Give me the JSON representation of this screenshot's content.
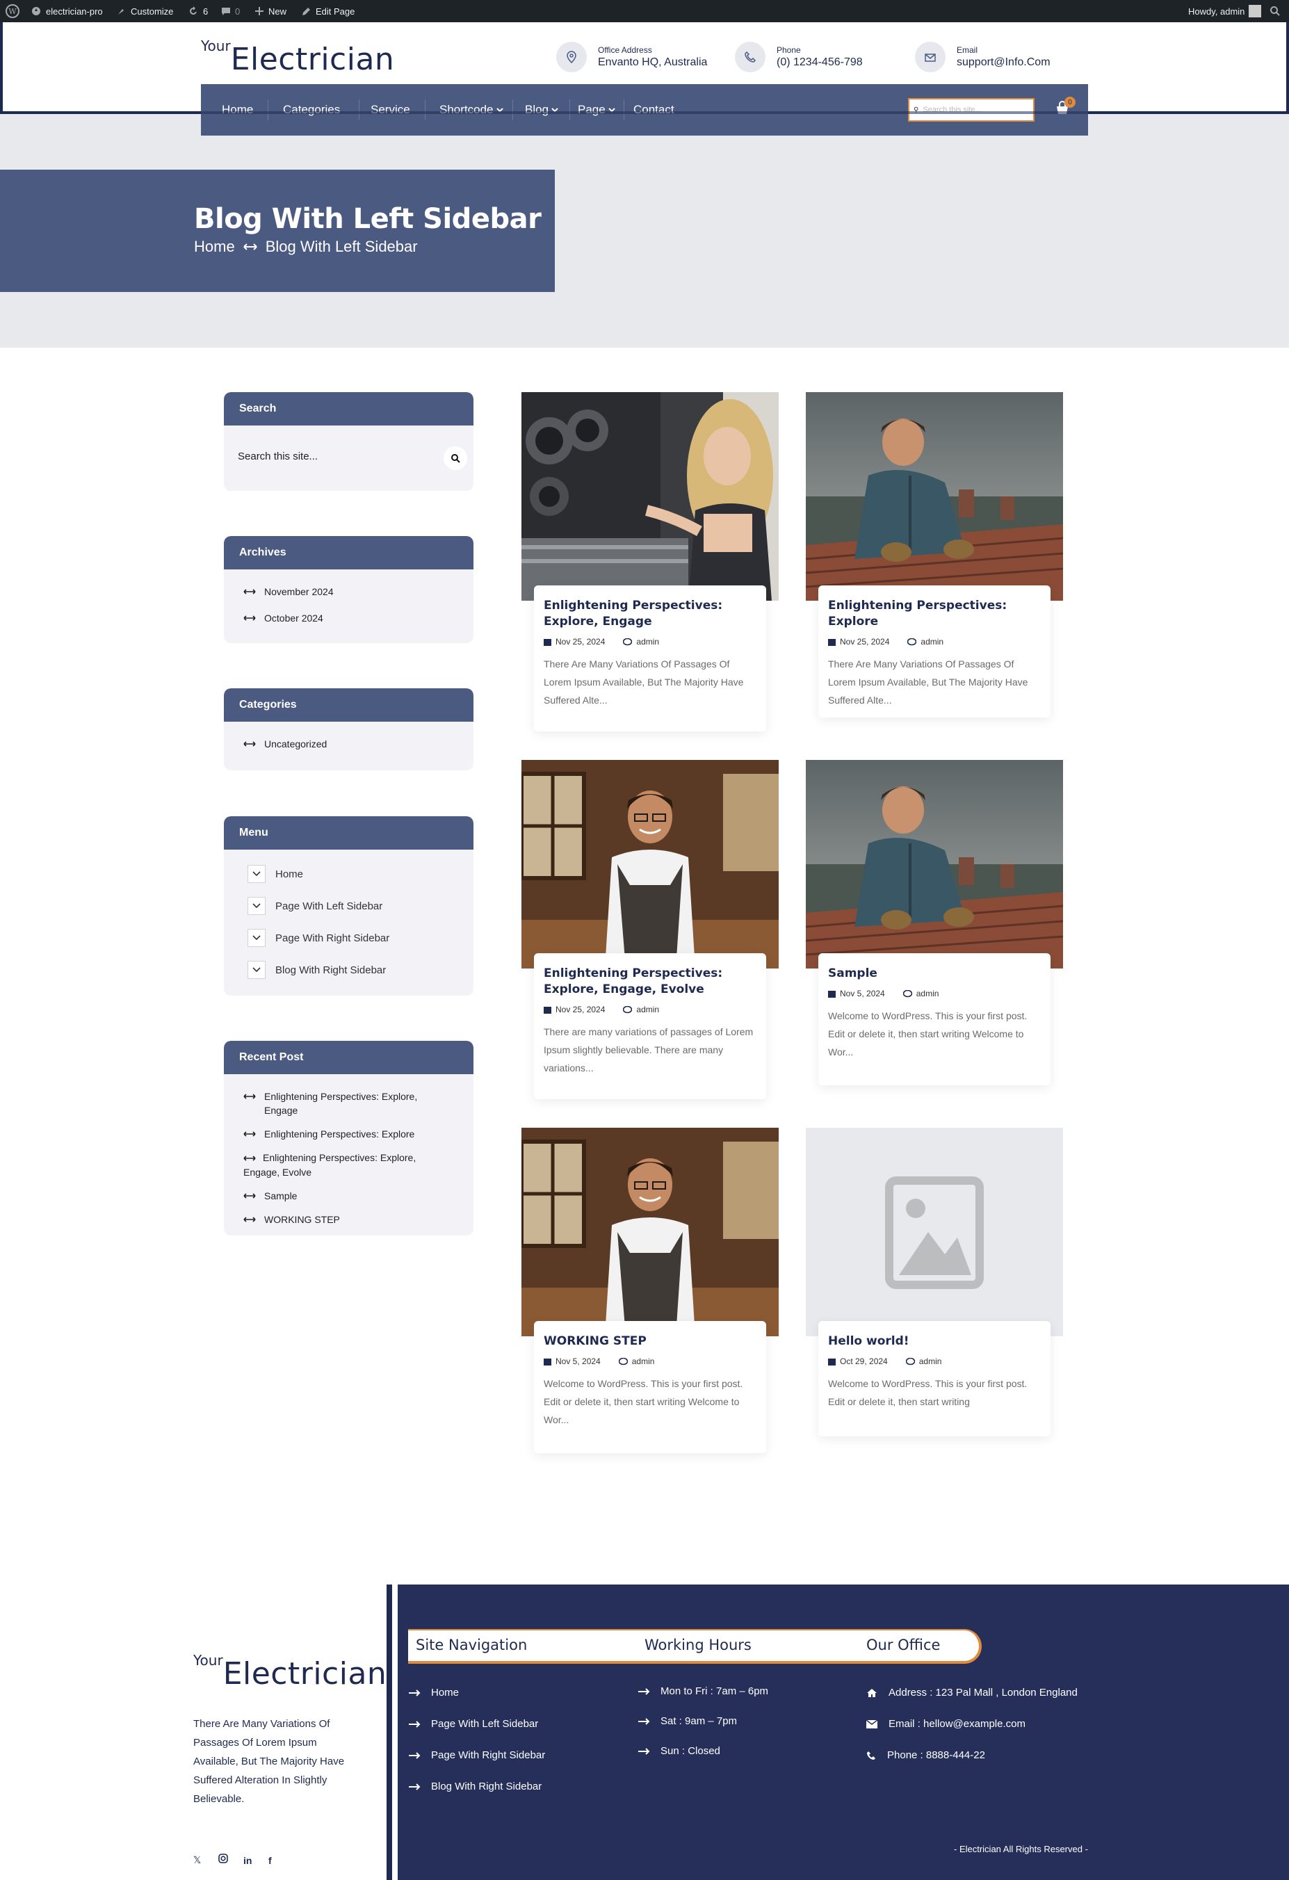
{
  "admin_bar": {
    "site": "electrician-pro",
    "customize": "Customize",
    "updates": "6",
    "comments": "0",
    "new": "New",
    "edit_page": "Edit Page",
    "howdy": "Howdy, admin"
  },
  "header": {
    "logo_your": "Your",
    "logo_name": "Electrician",
    "office_label": "Office Address",
    "office_value": "Envanto HQ, Australia",
    "phone_label": "Phone",
    "phone_value": "(0) 1234-456-798",
    "email_label": "Email",
    "email_value": "support@Info.Com"
  },
  "nav": {
    "items": [
      "Home",
      "Categories",
      "Service",
      "Shortcode",
      "Blog",
      "Page",
      "Contact"
    ],
    "search_placeholder": "Search this site...",
    "cart_count": "0"
  },
  "hero": {
    "title": "Blog With Left Sidebar",
    "crumb_home": "Home",
    "crumb_current": "Blog With Left Sidebar"
  },
  "sidebar": {
    "search_title": "Search",
    "search_placeholder": "Search this site...",
    "archives_title": "Archives",
    "archives": [
      "November 2024",
      "October 2024"
    ],
    "categories_title": "Categories",
    "categories": [
      "Uncategorized"
    ],
    "menu_title": "Menu",
    "menu": [
      "Home",
      "Page With Left Sidebar",
      "Page With Right Sidebar",
      "Blog With Right Sidebar"
    ],
    "recent_title": "Recent Post",
    "recent": [
      "Enlightening Perspectives: Explore, Engage",
      "Enlightening Perspectives: Explore",
      "Enlightening Perspectives: Explore, Engage, Evolve",
      "Sample",
      "WORKING STEP"
    ]
  },
  "posts": [
    {
      "title": "Enlightening Perspectives: Explore, Engage",
      "date": "Nov 25, 2024",
      "author": "admin",
      "excerpt": "There Are Many Variations Of Passages Of Lorem Ipsum Available, But The Majority Have Suffered Alte..."
    },
    {
      "title": "Enlightening Perspectives: Explore",
      "date": "Nov 25, 2024",
      "author": "admin",
      "excerpt": "There Are Many Variations Of Passages Of Lorem Ipsum Available, But The Majority Have Suffered Alte..."
    },
    {
      "title": "Enlightening Perspectives: Explore, Engage, Evolve",
      "date": "Nov 25, 2024",
      "author": "admin",
      "excerpt": "There are many variations of passages of Lorem Ipsum slightly believable. There are many variations..."
    },
    {
      "title": "Sample",
      "date": "Nov 5, 2024",
      "author": "admin",
      "excerpt": "Welcome to WordPress. This is your first post. Edit or delete it, then start writing Welcome to Wor..."
    },
    {
      "title": "WORKING STEP",
      "date": "Nov 5, 2024",
      "author": "admin",
      "excerpt": "Welcome to WordPress. This is your first post. Edit or delete it, then start writing Welcome to Wor..."
    },
    {
      "title": "Hello world!",
      "date": "Oct 29, 2024",
      "author": "admin",
      "excerpt": "Welcome to WordPress. This is your first post. Edit or delete it, then start writing"
    }
  ],
  "footer": {
    "logo_your": "Your",
    "logo_name": "Electrician",
    "about": "There Are Many Variations Of Passages Of Lorem Ipsum Available, But The Majority Have Suffered Alteration In Slightly Believable.",
    "nav_title": "Site Navigation",
    "nav": [
      "Home",
      "Page With Left Sidebar",
      "Page With Right Sidebar",
      "Blog With Right Sidebar"
    ],
    "hours_title": "Working Hours",
    "hours": [
      "Mon to Fri : 7am – 6pm",
      "Sat : 9am – 7pm",
      "Sun : Closed"
    ],
    "office_title": "Our Office",
    "address": "Address : 123 Pal Mall , London England",
    "email": "Email : hellow@example.com",
    "phone": "Phone : 8888-444-22",
    "copyright": "- Electrician All Rights Reserved -"
  },
  "colors": {
    "navy": "#1f2a50",
    "slate": "#4b5a80",
    "accent": "#e08a3c",
    "footer_bg": "#252f5a"
  }
}
